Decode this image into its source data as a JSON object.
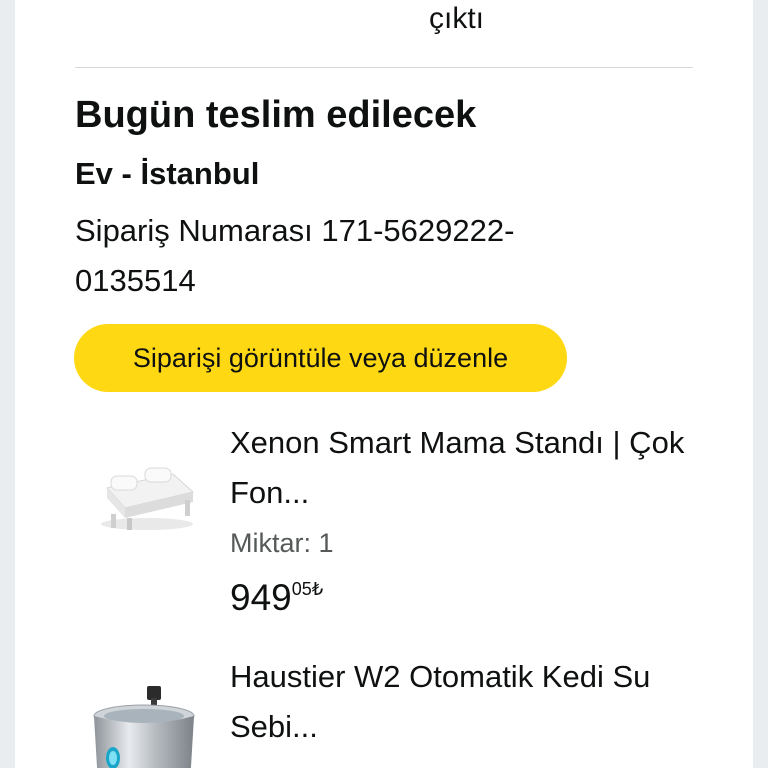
{
  "header": {
    "fragment_text": "çıktı"
  },
  "delivery": {
    "title": "Bugün teslim edilecek",
    "address": "Ev - İstanbul",
    "order_number": "Sipariş Numarası 171-5629222-0135514",
    "view_order_button": "Siparişi görüntüle veya düzenle"
  },
  "products": [
    {
      "title": "Xenon Smart Mama Standı | Çok Fon...",
      "quantity": "Miktar: 1",
      "price_whole": "949",
      "price_fraction": "05",
      "currency": "₺",
      "image_icon": "white-pet-bowl-stand-image"
    },
    {
      "title": "Haustier W2 Otomatik Kedi Su Sebi...",
      "image_icon": "steel-water-fountain-image"
    }
  ],
  "colors": {
    "button_yellow": "#ffd814",
    "text_primary": "#0f1111",
    "text_secondary": "#565959",
    "divider": "#d5d9d9"
  }
}
